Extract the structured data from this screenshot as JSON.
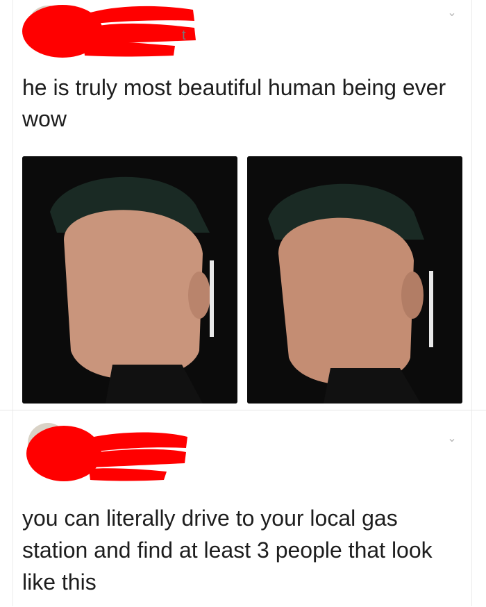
{
  "posts": [
    {
      "author_tail": "t",
      "text": "he is truly most beautiful human being ever wow",
      "media": [
        {
          "alt": "photo 1"
        },
        {
          "alt": "photo 2"
        }
      ]
    },
    {
      "text": "you can literally drive to your local gas station and find at least 3 people that look like this"
    }
  ],
  "colors": {
    "redaction": "#ff0000",
    "chevron": "#b5b5b5",
    "text": "#1d1d1d",
    "photo_background": "#0b0b0b"
  },
  "icons": {
    "menu_chevron": "chevron-down-icon"
  }
}
